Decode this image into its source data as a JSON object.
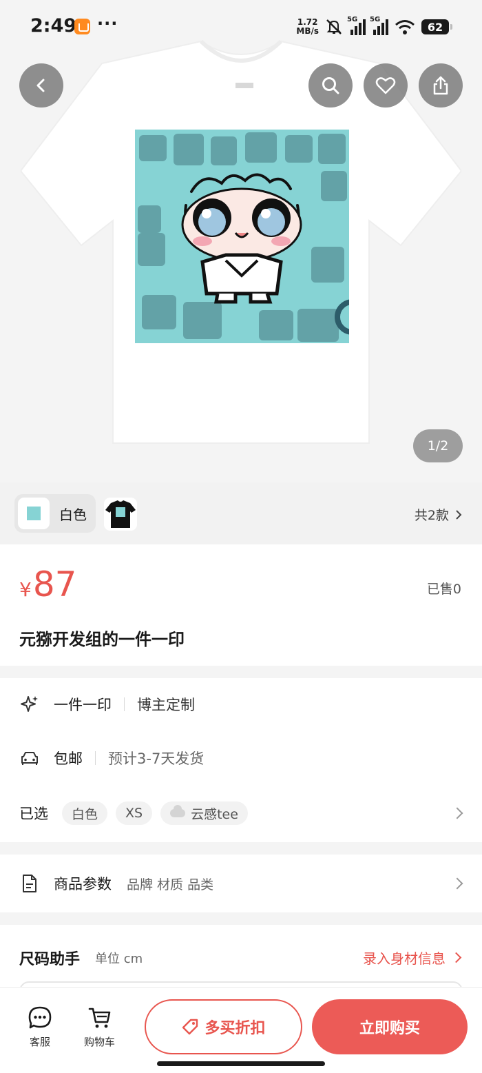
{
  "status_bar": {
    "time": "2:49",
    "more": "···",
    "net_speed_value": "1.72",
    "net_speed_unit": "MB/s",
    "signal1_label": "5G",
    "signal2_label": "5G",
    "battery": "62"
  },
  "gallery": {
    "counter": "1/2"
  },
  "variants": {
    "selected_label": "白色",
    "total": "共2款"
  },
  "product": {
    "currency": "¥",
    "price": "87",
    "sold": "已售0",
    "title": "元猕开发组的一件一印"
  },
  "services": {
    "custom_main": "一件一印",
    "custom_sub": "博主定制",
    "shipping_main": "包邮",
    "shipping_sub": "预计3-7天发货",
    "selected_label": "已选",
    "chips": [
      "白色",
      "XS",
      "云感tee"
    ]
  },
  "params": {
    "label": "商品参数",
    "items": "品牌 材质 品类"
  },
  "size_helper": {
    "title": "尺码助手",
    "unit": "单位 cm",
    "link": "录入身材信息"
  },
  "bottom_bar": {
    "service_label": "客服",
    "cart_label": "购物车",
    "discount_label": "多买折扣",
    "buy_label": "立即购买"
  },
  "colors": {
    "accent": "#e8554e",
    "buy_button": "#ec5b57",
    "design_bg": "#86d3d4"
  }
}
